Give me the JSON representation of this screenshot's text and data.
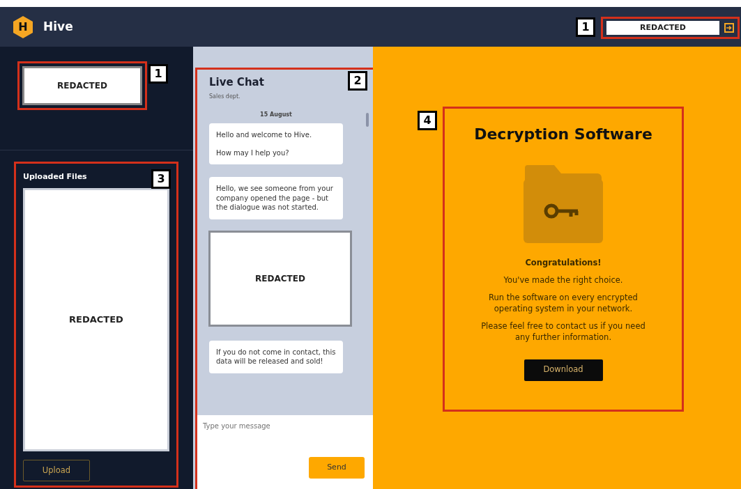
{
  "header": {
    "logo_letter": "H",
    "title": "Hive",
    "account": "REDACTED",
    "annotation": "1"
  },
  "account_panel": {
    "name": "REDACTED",
    "annotation": "1"
  },
  "files": {
    "title": "Uploaded Files",
    "content": "REDACTED",
    "upload_button": "Upload",
    "annotation": "3"
  },
  "chat": {
    "title": "Live Chat",
    "subtitle": "Sales dept.",
    "date": "15 August",
    "annotation": "2",
    "messages": [
      {
        "kind": "text",
        "lines": [
          "Hello and welcome to Hive.",
          "How may I help you?"
        ]
      },
      {
        "kind": "text",
        "lines": [
          "Hello, we see someone from your company opened the page - but the dialogue was not started."
        ]
      },
      {
        "kind": "redacted",
        "lines": [
          "REDACTED"
        ]
      },
      {
        "kind": "text",
        "lines": [
          "If you do not come in contact, this data will be released and sold!"
        ]
      }
    ],
    "input": {
      "placeholder": "Type your message"
    },
    "send_button": "Send"
  },
  "download_card": {
    "title": "Decryption Software",
    "heading": "Congratulations!",
    "annotation": "4",
    "paragraphs": [
      "You've made the right choice.",
      "Run the software on every encrypted operating system in your network.",
      "Please feel free to contact us if you need any further information."
    ],
    "button": "Download"
  }
}
